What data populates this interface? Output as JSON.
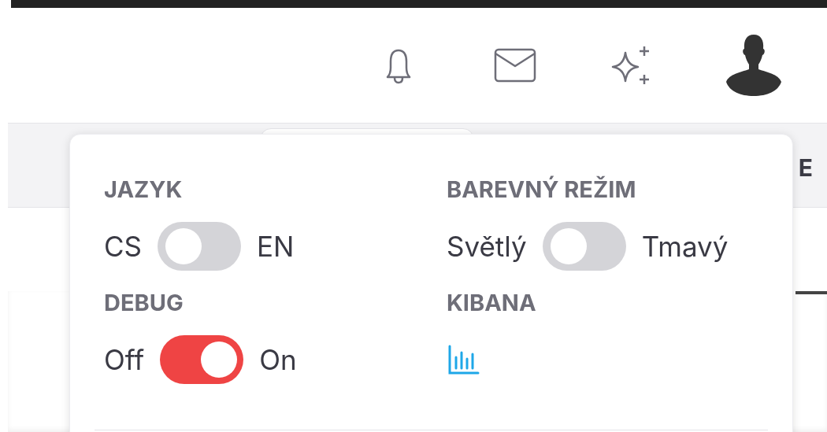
{
  "background_tab_letter": "E",
  "settings": [
    {
      "kind": "toggle",
      "title": "JAZYK",
      "off_label": "CS",
      "on_label": "EN",
      "on": false
    },
    {
      "kind": "toggle",
      "title": "BAREVNÝ REŽIM",
      "off_label": "Světlý",
      "on_label": "Tmavý",
      "on": false
    },
    {
      "kind": "toggle",
      "title": "DEBUG",
      "off_label": "Off",
      "on_label": "On",
      "on": true
    },
    {
      "kind": "link",
      "title": "KIBANA"
    }
  ]
}
